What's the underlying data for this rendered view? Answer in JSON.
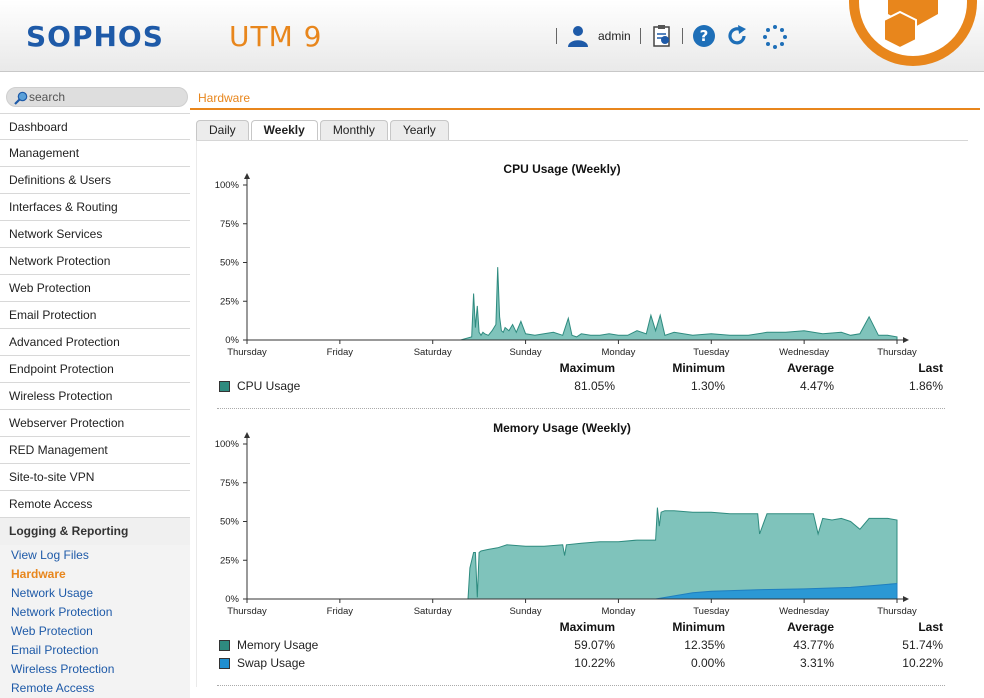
{
  "header": {
    "brand": "SOPHOS",
    "product": "UTM 9",
    "user": "admin",
    "brand_color": "#1e5aa8",
    "accent_color": "#e8861c",
    "icons": [
      "user-icon",
      "documentation-icon",
      "help-icon",
      "reload-icon",
      "activity-spinner-icon",
      "sophos-logo-icon"
    ]
  },
  "sidebar": {
    "search_placeholder": "search",
    "menu": [
      "Dashboard",
      "Management",
      "Definitions & Users",
      "Interfaces & Routing",
      "Network Services",
      "Network Protection",
      "Web Protection",
      "Email Protection",
      "Advanced Protection",
      "Endpoint Protection",
      "Wireless Protection",
      "Webserver Protection",
      "RED Management",
      "Site-to-site VPN",
      "Remote Access",
      "Logging & Reporting"
    ],
    "submenu": [
      "View Log Files",
      "Hardware",
      "Network Usage",
      "Network Protection",
      "Web Protection",
      "Email Protection",
      "Wireless Protection",
      "Remote Access"
    ],
    "active_submenu": "Hardware"
  },
  "main": {
    "breadcrumb": "Hardware",
    "tabs": [
      "Daily",
      "Weekly",
      "Monthly",
      "Yearly"
    ],
    "active_tab": "Weekly"
  },
  "stats_headers": [
    "Maximum",
    "Minimum",
    "Average",
    "Last"
  ],
  "cpu": {
    "title": "CPU Usage (Weekly)",
    "rows": [
      {
        "name": "CPU Usage",
        "color": "#2e8b7f",
        "values": [
          "81.05%",
          "1.30%",
          "4.47%",
          "1.86%"
        ]
      }
    ]
  },
  "memory": {
    "title": "Memory Usage (Weekly)",
    "rows": [
      {
        "name": "Memory Usage",
        "color": "#2e8b7f",
        "values": [
          "59.07%",
          "12.35%",
          "43.77%",
          "51.74%"
        ]
      },
      {
        "name": "Swap Usage",
        "color": "#1f8fd0",
        "values": [
          "10.22%",
          "0.00%",
          "3.31%",
          "10.22%"
        ]
      }
    ]
  },
  "chart_data": [
    {
      "type": "area",
      "title": "CPU Usage (Weekly)",
      "xlabel": "",
      "ylabel": "",
      "x_ticks": [
        "Thursday",
        "Friday",
        "Saturday",
        "Sunday",
        "Monday",
        "Tuesday",
        "Wednesday",
        "Thursday"
      ],
      "y_ticks": [
        "0%",
        "25%",
        "50%",
        "75%",
        "100%"
      ],
      "ylim": [
        0,
        100
      ],
      "xlim": [
        0,
        7
      ],
      "series": [
        {
          "name": "CPU Usage",
          "color": "#7fc3bb",
          "x": [
            0,
            2.3,
            2.42,
            2.44,
            2.46,
            2.48,
            2.5,
            2.52,
            2.54,
            2.56,
            2.6,
            2.64,
            2.68,
            2.7,
            2.72,
            2.74,
            2.76,
            2.78,
            2.82,
            2.86,
            2.9,
            2.95,
            3.0,
            3.1,
            3.2,
            3.3,
            3.4,
            3.46,
            3.5,
            3.55,
            3.6,
            3.7,
            3.8,
            3.9,
            4.0,
            4.1,
            4.2,
            4.3,
            4.35,
            4.4,
            4.45,
            4.5,
            4.6,
            4.8,
            5.0,
            5.2,
            5.4,
            5.6,
            5.8,
            6.0,
            6.2,
            6.4,
            6.5,
            6.6,
            6.7,
            6.8,
            6.9,
            7.0
          ],
          "y": [
            0,
            0,
            2,
            30,
            8,
            22,
            5,
            3,
            5,
            4,
            3,
            6,
            10,
            47,
            15,
            6,
            5,
            8,
            6,
            10,
            5,
            12,
            4,
            3,
            4,
            5,
            3,
            14,
            3,
            2,
            4,
            3,
            3,
            4,
            3,
            3,
            6,
            4,
            16,
            6,
            16,
            3,
            5,
            3,
            4,
            3,
            3,
            5,
            5,
            6,
            4,
            5,
            3,
            4,
            15,
            3,
            3,
            2
          ]
        }
      ]
    },
    {
      "type": "area",
      "title": "Memory Usage (Weekly)",
      "xlabel": "",
      "ylabel": "",
      "x_ticks": [
        "Thursday",
        "Friday",
        "Saturday",
        "Sunday",
        "Monday",
        "Tuesday",
        "Wednesday",
        "Thursday"
      ],
      "y_ticks": [
        "0%",
        "25%",
        "50%",
        "75%",
        "100%"
      ],
      "ylim": [
        0,
        100
      ],
      "xlim": [
        0,
        7
      ],
      "series": [
        {
          "name": "Memory Usage",
          "color": "#7fc3bb",
          "x": [
            0,
            2.38,
            2.4,
            2.44,
            2.46,
            2.48,
            2.5,
            2.52,
            2.6,
            2.7,
            2.8,
            3.0,
            3.2,
            3.4,
            3.42,
            3.44,
            3.6,
            3.8,
            4.0,
            4.2,
            4.4,
            4.42,
            4.44,
            4.46,
            4.5,
            4.6,
            4.8,
            5.0,
            5.2,
            5.4,
            5.5,
            5.52,
            5.6,
            5.8,
            6.0,
            6.1,
            6.15,
            6.2,
            6.3,
            6.4,
            6.5,
            6.6,
            6.7,
            6.8,
            6.9,
            7.0
          ],
          "y": [
            0,
            0,
            20,
            30,
            30,
            1,
            30,
            31,
            32,
            33,
            35,
            34,
            34,
            35,
            28,
            35,
            36,
            37,
            37,
            38,
            38,
            59,
            47,
            56,
            57,
            57,
            56,
            56,
            55,
            55,
            55,
            42,
            55,
            55,
            55,
            55,
            42,
            52,
            51,
            52,
            50,
            45,
            52,
            52,
            52,
            51
          ]
        },
        {
          "name": "Swap Usage",
          "color": "#2b98d4",
          "x": [
            0,
            4.4,
            4.6,
            4.8,
            5.0,
            5.5,
            6.0,
            6.5,
            6.8,
            7.0
          ],
          "y": [
            0,
            0,
            2,
            4,
            5,
            6,
            6.5,
            7.5,
            9,
            10
          ]
        }
      ]
    }
  ]
}
